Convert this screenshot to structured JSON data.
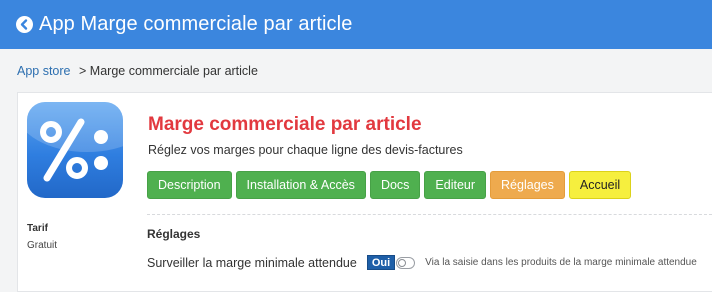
{
  "header": {
    "back_icon": "chevron-left-circle-icon",
    "title": "App Marge commerciale par article",
    "color": "#3b86de"
  },
  "breadcrumb": {
    "root": "App store",
    "separator": ">",
    "current": "Marge commerciale par article"
  },
  "app": {
    "icon": "percent-icon",
    "title": "Marge commerciale par article",
    "title_color": "#e2393f",
    "subtitle": "Réglez vos marges pour chaque ligne des devis-factures"
  },
  "buttons": [
    {
      "label": "Description",
      "color": "#4fb04f"
    },
    {
      "label": "Installation & Accès",
      "color": "#4fb04f"
    },
    {
      "label": "Docs",
      "color": "#4fb04f"
    },
    {
      "label": "Editeur",
      "color": "#4fb04f"
    },
    {
      "label": "Réglages",
      "color": "#eeaa4e"
    },
    {
      "label": "Accueil",
      "color": "#f6ef3e"
    }
  ],
  "tarif": {
    "label": "Tarif",
    "value": "Gratuit"
  },
  "settings": {
    "section_title": "Réglages",
    "items": [
      {
        "label": "Surveiller la marge minimale attendue",
        "toggle_label": "Oui",
        "hint": "Via la saisie dans les produits de la marge minimale attendue"
      }
    ]
  }
}
